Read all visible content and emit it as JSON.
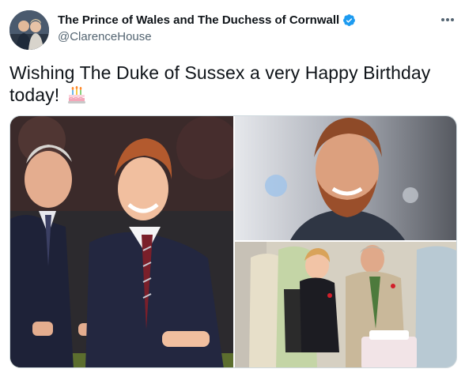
{
  "author": {
    "display_name": "The Prince of Wales and The Duchess of Cornwall",
    "handle": "@ClarenceHouse",
    "verified": true,
    "avatar_icon": "profile-photo"
  },
  "more_icon": "more-horizontal-icon",
  "tweet": {
    "text": "Wishing The Duke of Sussex a very Happy Birthday today!",
    "emoji_icon": "birthday-cake-emoji"
  },
  "media": {
    "count": 3,
    "photos": [
      "photo-1",
      "photo-2",
      "photo-3"
    ]
  },
  "colors": {
    "text_primary": "#0f1419",
    "text_secondary": "#536471",
    "verified_blue": "#1d9bf0",
    "border": "#cfd9de"
  }
}
